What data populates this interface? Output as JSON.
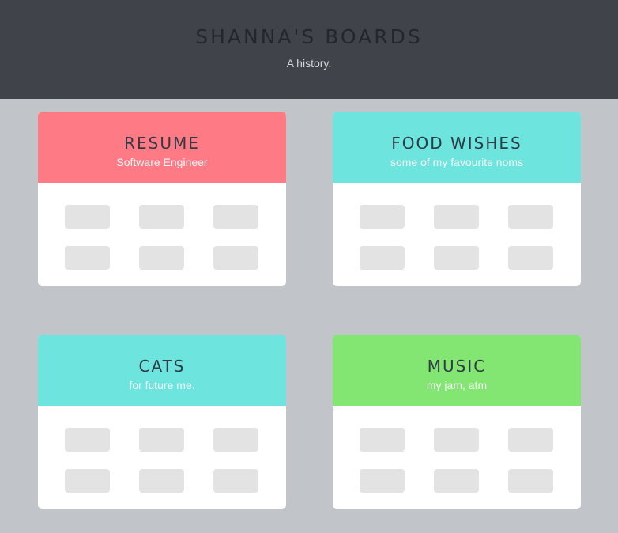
{
  "header": {
    "title": "SHANNA'S BOARDS",
    "subtitle": "A history."
  },
  "colors": {
    "header_bg": "#404349",
    "page_bg": "#c1c5c9",
    "red": "#fe7b85",
    "teal": "#6de4dd",
    "green": "#83e672",
    "pin": "#e3e3e3"
  },
  "boards": [
    {
      "name": "RESUME",
      "description": "Software Engineer",
      "color": "#fe7b85"
    },
    {
      "name": "FOOD WISHES",
      "description": "some of my favourite noms",
      "color": "#6de4dd"
    },
    {
      "name": "CATS",
      "description": "for future me.",
      "color": "#6de4dd"
    },
    {
      "name": "MUSIC",
      "description": "my jam, atm",
      "color": "#83e672"
    }
  ]
}
